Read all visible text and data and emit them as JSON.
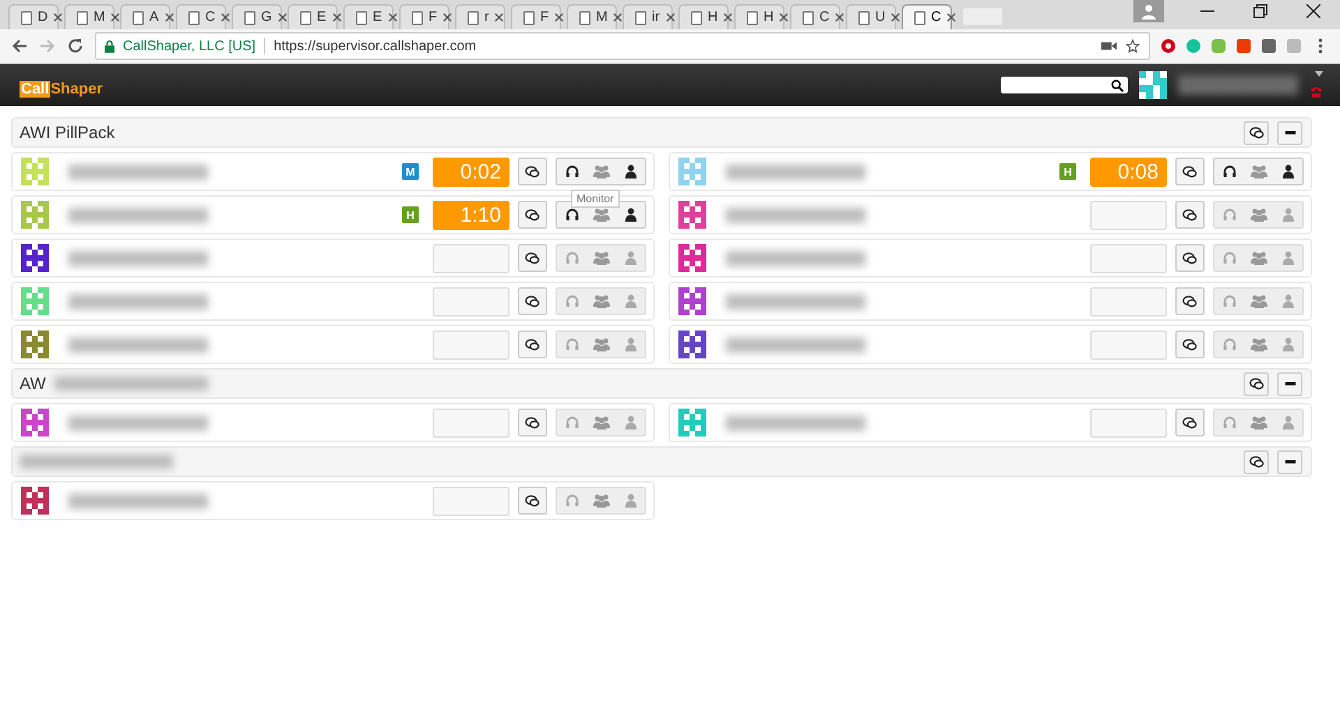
{
  "browser": {
    "tabs": [
      {
        "label": "D",
        "selected": false
      },
      {
        "label": "M",
        "selected": false
      },
      {
        "label": "A",
        "selected": false
      },
      {
        "label": "C",
        "selected": false
      },
      {
        "label": "G",
        "selected": false
      },
      {
        "label": "E",
        "selected": false
      },
      {
        "label": "E",
        "selected": false
      },
      {
        "label": "F",
        "selected": false
      },
      {
        "label": "r",
        "selected": false
      },
      {
        "label": "F",
        "selected": false
      },
      {
        "label": "M",
        "selected": false
      },
      {
        "label": "ir",
        "selected": false
      },
      {
        "label": "H",
        "selected": false
      },
      {
        "label": "H",
        "selected": false
      },
      {
        "label": "C",
        "selected": false
      },
      {
        "label": "U",
        "selected": false
      },
      {
        "label": "C",
        "selected": true
      }
    ],
    "site_identity": "CallShaper, LLC [US]",
    "url": "https://supervisor.callshaper.com"
  },
  "app": {
    "logo_left": "Call",
    "logo_right": "Shaper"
  },
  "groups": [
    {
      "title": "AWI PillPack",
      "redacted": false,
      "agents": [
        {
          "color": "#c5e05a",
          "badge": {
            "label": "M",
            "color": "#1e90d0"
          },
          "timer": "0:02",
          "on_call": true
        },
        {
          "color": "#8fd3f0",
          "badge": {
            "label": "H",
            "color": "#66a020"
          },
          "timer": "0:08",
          "on_call": true
        },
        {
          "color": "#a8c84a",
          "badge": {
            "label": "H",
            "color": "#66a020"
          },
          "timer": "1:10",
          "on_call": true,
          "tooltip": "Monitor"
        },
        {
          "color": "#e0409a",
          "on_call": false
        },
        {
          "color": "#5522cc",
          "on_call": false
        },
        {
          "color": "#e02a9a",
          "on_call": false
        },
        {
          "color": "#66dd88",
          "on_call": false
        },
        {
          "color": "#b040d0",
          "on_call": false
        },
        {
          "color": "#8a8a30",
          "on_call": false
        },
        {
          "color": "#6644cc",
          "on_call": false
        }
      ]
    },
    {
      "title": "AW",
      "redacted": true,
      "agents": [
        {
          "color": "#cc44cc",
          "on_call": false
        },
        {
          "color": "#22ccbb",
          "on_call": false
        }
      ]
    },
    {
      "redacted": true,
      "agents": [
        {
          "color": "#c0305a",
          "on_call": false
        }
      ]
    }
  ]
}
